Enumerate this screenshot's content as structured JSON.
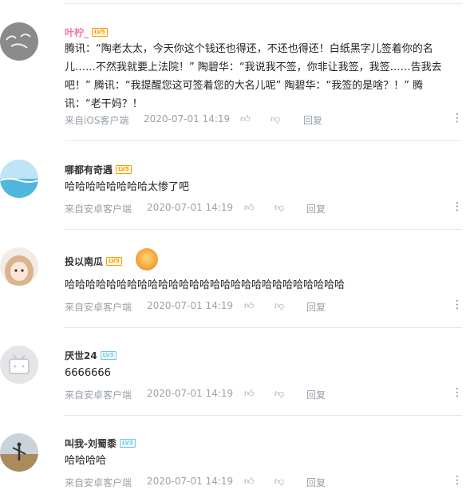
{
  "comments": [
    {
      "user": "叶柠_",
      "level": "LV5",
      "text": "腾讯：“陶老太太，今天你这个钱还也得还，不还也得还！白纸黑字儿签着你的名儿……不然我就要上法院！” 陶碧华：“我说我不签，你非让我签，我签……告我去吧！” 腾讯：“我提醒您这可签着您的大名儿呢” 陶碧华：“我签的是啥？！” 腾讯：“老干妈？！",
      "source": "来自iOS客户端",
      "time": "2020-07-01 14:19",
      "reply": "回复"
    },
    {
      "user": "哪都有奇遇",
      "level": "LV5",
      "text": "哈哈哈哈哈哈哈哈太惨了吧",
      "source": "来自安卓客户端",
      "time": "2020-07-01 14:19",
      "reply": "回复"
    },
    {
      "user": "投以南瓜",
      "level": "LV5",
      "text": "哈哈哈哈哈哈哈哈哈哈哈哈哈哈哈哈哈哈哈哈哈哈哈哈哈哈哈",
      "source": "来自安卓客户端",
      "time": "2020-07-01 14:19",
      "reply": "回复"
    },
    {
      "user": "厌世24",
      "level": "LV3",
      "text": "6666666",
      "source": "来自安卓客户端",
      "time": "2020-07-01 14:19",
      "reply": "回复"
    },
    {
      "user": "叫我-刘蜀黍",
      "level": "LV3",
      "text": "哈哈哈哈",
      "source": "来自安卓客户端",
      "time": "2020-07-01 14:19",
      "reply": "回复"
    }
  ],
  "icons": {
    "like": "thumbs-up-icon",
    "dislike": "thumbs-down-icon",
    "more": "vertical-ellipsis-icon"
  },
  "colors": {
    "username_highlight": "#fb7299",
    "lv5": "#ff9c00",
    "lv3": "#73c9e5",
    "meta": "#99a2aa"
  }
}
